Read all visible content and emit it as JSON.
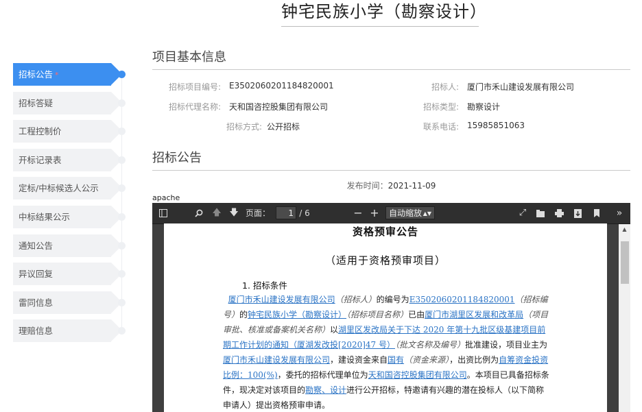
{
  "page_title": "钟宅民族小学（勘察设计）",
  "sidebar": {
    "items": [
      {
        "label": "招标公告",
        "active": true,
        "star": "*"
      },
      {
        "label": "招标答疑"
      },
      {
        "label": "工程控制价"
      },
      {
        "label": "开标记录表"
      },
      {
        "label": "定标/中标候选人公示"
      },
      {
        "label": "中标结果公示"
      },
      {
        "label": "通知公告"
      },
      {
        "label": "异议回复"
      },
      {
        "label": "雷同信息"
      },
      {
        "label": "理赔信息"
      }
    ]
  },
  "basic_info": {
    "title": "项目基本信息",
    "project_no_label": "招标项目编号:",
    "project_no": "E3502060201184820001",
    "tenderer_label": "招标人:",
    "tenderer": "厦门市禾山建设发展有限公司",
    "agent_label": "招标代理名称:",
    "agent": "天和国咨控股集团有限公司",
    "type_label": "招标类型:",
    "type": "勘察设计",
    "method_label": "招标方式:",
    "method": "公开招标",
    "phone_label": "联系电话:",
    "phone": "15985851063"
  },
  "announcement": {
    "title": "招标公告",
    "publish_label": "发布时间：",
    "publish_time": "2021-11-09"
  },
  "pdf_viewer": {
    "apache_label": "apache",
    "page_label": "页面：",
    "current_page": "1",
    "total_pages": "/ 6",
    "zoom_value": "自动缩放",
    "icons": [
      "sidebar-toggle-icon",
      "search-icon",
      "prev-page-icon",
      "next-page-icon",
      "zoom-out-icon",
      "zoom-in-icon",
      "presentation-icon",
      "open-file-icon",
      "print-icon",
      "download-icon",
      "bookmark-icon",
      "more-tools-icon"
    ]
  },
  "document": {
    "heading": "资格预审公告",
    "subheading": "（适用于资格预审项目）",
    "section1": "1.  招标条件",
    "p1_a": "厦门市禾山建设发展有限公司",
    "p1_b": "（招标人）",
    "p1_c": "的编号为",
    "p1_d": "E3502060201184820001",
    "p1_e": "（招标编号）",
    "p1_f": "的",
    "p1_g": "钟宅民族小学（勘察设计）",
    "p1_h": "（招标项目名称）",
    "p1_i": "已由",
    "p1_j": "厦门市湖里区发展和改革局",
    "p1_k": "（项目审批、核准或备案机关名称）",
    "p1_l": "以",
    "p1_m": "湖里区发改局关于下达 2020 年第十九批区级基建项目前期工作计划的通知（厦湖发改投[2020]47 号）",
    "p1_n": "（批文名称及编号）",
    "p1_o": "批准建设，项目业主为",
    "p1_p": "厦门市禾山建设发展有限公司",
    "p1_q": "，建设资金来自",
    "p1_r": "国有",
    "p1_s": "（资金来源）",
    "p1_t": "，出资比例为",
    "p1_u": "自筹资金投资比例：100(%)",
    "p1_v": "，委托的招标代理单位为",
    "p1_w": "天和国咨控股集团有限公司",
    "p1_x": "。本项目已具备招标条件，现决定对该项目的",
    "p1_y": "勘察、设计",
    "p1_z": "进行公开招标，特邀请有兴趣的潜在投标人（以下简称申请人）提出资格预审申请。"
  },
  "colors": {
    "accent": "#3c8ff0",
    "link": "#2a73c5",
    "toolbar": "#2f2f2f"
  }
}
